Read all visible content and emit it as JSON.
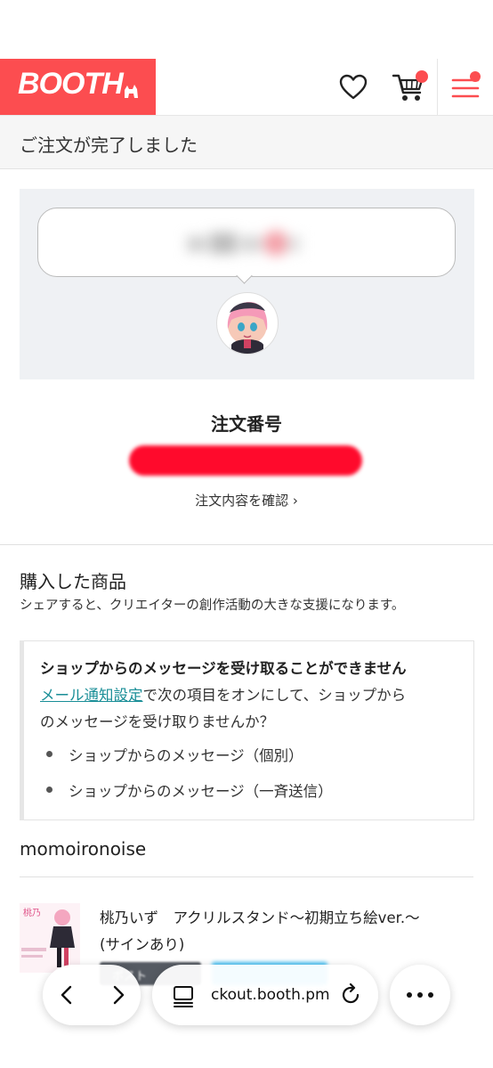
{
  "header": {
    "logo_text": "BOOTH",
    "icons": [
      "heart-icon",
      "cart-icon",
      "menu-icon"
    ],
    "brand_color": "#fc4d50"
  },
  "title_bar": {
    "title": "ご注文が完了しました"
  },
  "order": {
    "label": "注文番号",
    "details_link": "注文内容を確認 ›"
  },
  "purchased": {
    "title": "購入した商品",
    "subtitle": "シェアすると、クリエイターの創作活動の大きな支援になります。"
  },
  "message_box": {
    "title": "ショップからのメッセージを受け取ることができません",
    "link_text": "メール通知設定",
    "line1_rest": "で次の項目をオンにして、ショップから",
    "line2": "のメッセージを受け取りませんか？",
    "options": [
      "ショップからのメッセージ（個別）",
      "ショップからのメッセージ（一斉送信）"
    ]
  },
  "shop": {
    "name": "momoironoise"
  },
  "item": {
    "title_line1": "桃乃いず　アクリルスタンド〜初期立ち絵ver.〜",
    "title_line2": "(サインあり)",
    "post_button": "ポスト"
  },
  "browser": {
    "url": "ckout.booth.pm",
    "icons": [
      "back-icon",
      "forward-icon",
      "tabs-icon",
      "reload-icon",
      "more-icon"
    ]
  }
}
